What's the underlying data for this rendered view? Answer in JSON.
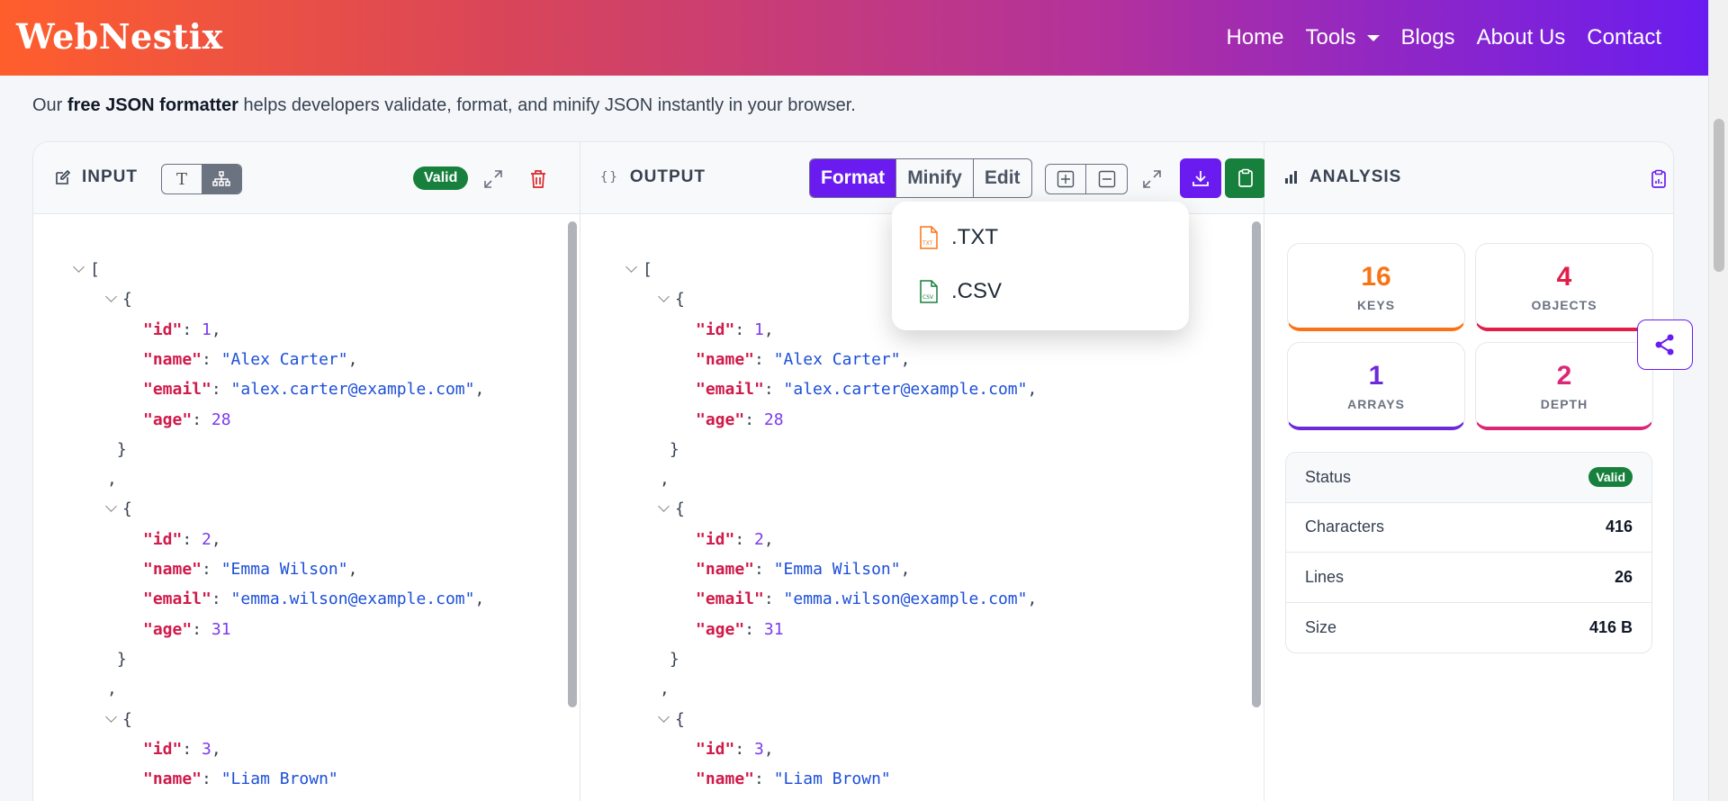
{
  "header": {
    "logo": "WebNestix",
    "nav": [
      "Home",
      "Tools",
      "Blogs",
      "About Us",
      "Contact"
    ]
  },
  "intro": {
    "prefix": "Our ",
    "bold": "free JSON formatter",
    "suffix": " helps developers validate, format, and minify JSON instantly in your browser."
  },
  "input_panel": {
    "title": "INPUT",
    "view_text_label": "T",
    "status": "Valid"
  },
  "output_panel": {
    "title": "OUTPUT",
    "brace_glyph": "{}",
    "buttons": [
      "Format",
      "Minify",
      "Edit"
    ],
    "download_menu": [
      ".TXT",
      ".CSV"
    ]
  },
  "analysis_panel": {
    "title": "ANALYSIS",
    "stats": [
      {
        "value": "16",
        "label": "KEYS",
        "color": "#f97316"
      },
      {
        "value": "4",
        "label": "OBJECTS",
        "color": "#e11d48"
      },
      {
        "value": "1",
        "label": "ARRAYS",
        "color": "#6d28d9"
      },
      {
        "value": "2",
        "label": "DEPTH",
        "color": "#db2777"
      }
    ],
    "info": [
      {
        "label": "Status",
        "value": "Valid"
      },
      {
        "label": "Characters",
        "value": "416"
      },
      {
        "label": "Lines",
        "value": "26"
      },
      {
        "label": "Size",
        "value": "416 B"
      }
    ]
  },
  "json_records": [
    {
      "id": "1",
      "name": "\"Alex Carter\"",
      "email": "\"alex.carter@example.com\"",
      "age": "28"
    },
    {
      "id": "2",
      "name": "\"Emma Wilson\"",
      "email": "\"emma.wilson@example.com\"",
      "age": "31"
    },
    {
      "id": "3",
      "name": "\"Liam Brown\""
    }
  ],
  "colors": {
    "accent": "#6a1cf0",
    "valid": "#16803c",
    "key": "#d01a4a",
    "string": "#1c4fd8",
    "number": "#7c3aed"
  }
}
